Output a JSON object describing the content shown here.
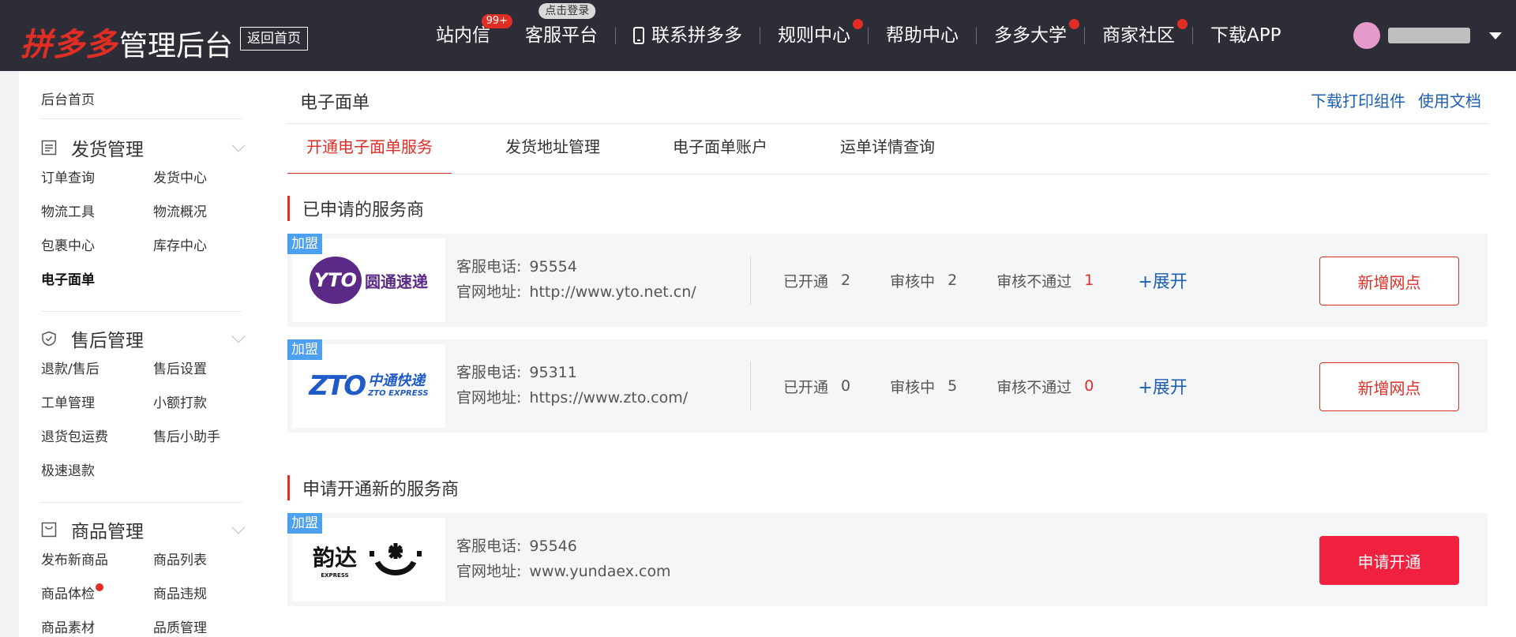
{
  "topbar": {
    "logo_brand": "拼多多",
    "logo_title": "管理后台",
    "back_home": "返回首页",
    "nav": [
      {
        "label": "站内信",
        "badge": "99+"
      },
      {
        "label": "客服平台",
        "tip": "点击登录"
      },
      {
        "label": "联系拼多多",
        "icon": "phone-icon"
      },
      {
        "label": "规则中心",
        "dot": true
      },
      {
        "label": "帮助中心"
      },
      {
        "label": "多多大学",
        "dot": true
      },
      {
        "label": "商家社区",
        "dot": true
      },
      {
        "label": "下载APP"
      }
    ]
  },
  "sidebar": {
    "home": "后台首页",
    "groups": [
      {
        "title": "发货管理",
        "icon": "document-icon",
        "items": [
          "订单查询",
          "发货中心",
          "物流工具",
          "物流概况",
          "包裹中心",
          "库存中心",
          "电子面单"
        ]
      },
      {
        "title": "售后管理",
        "icon": "shield-icon",
        "items": [
          "退款/售后",
          "售后设置",
          "工单管理",
          "小额打款",
          "退货包运费",
          "售后小助手",
          "极速退款"
        ]
      },
      {
        "title": "商品管理",
        "icon": "bag-icon",
        "items": [
          "发布新商品",
          "商品列表",
          "商品体检",
          "商品违规",
          "商品素材",
          "品质管理"
        ]
      }
    ],
    "active_item": "电子面单"
  },
  "main": {
    "title": "电子面单",
    "links": [
      "下载打印组件",
      "使用文档"
    ],
    "tabs": [
      "开通电子面单服务",
      "发货地址管理",
      "电子面单账户",
      "运单详情查询"
    ],
    "active_tab": 0,
    "section_applied": "已申请的服务商",
    "section_new": "申请开通新的服务商",
    "join_tag": "加盟",
    "phone_label": "客服电话:",
    "site_label": "官网地址:",
    "opened_label": "已开通",
    "review_label": "审核中",
    "rejected_label": "审核不通过",
    "expand_label": "+展开",
    "add_site_label": "新增网点",
    "apply_label": "申请开通",
    "carriers_applied": [
      {
        "logo_name": "圆通速递",
        "logo_mark": "YTO",
        "phone": "95554",
        "site": "http://www.yto.net.cn/",
        "opened": "2",
        "reviewing": "2",
        "rejected": "1"
      },
      {
        "logo_name": "中通快递",
        "logo_sub": "ZTO EXPRESS",
        "logo_mark": "ZTO",
        "phone": "95311",
        "site": "https://www.zto.com/",
        "opened": "0",
        "reviewing": "5",
        "rejected": "0"
      }
    ],
    "carriers_new": [
      {
        "logo_name": "韵达",
        "logo_sub": "EXPRESS",
        "phone": "95546",
        "site": "www.yundaex.com"
      }
    ]
  }
}
